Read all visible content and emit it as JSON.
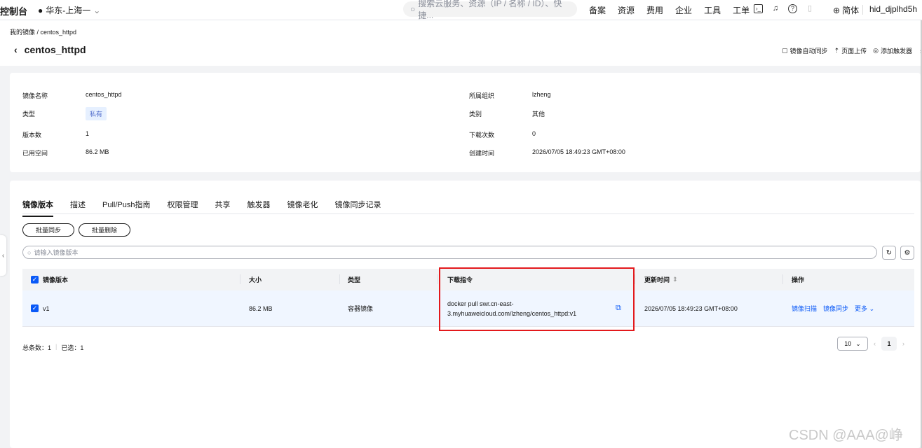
{
  "topbar": {
    "brand": "控制台",
    "region": "华东-上海一",
    "search_placeholder": "搜索云服务、资源（IP / 名称 / ID）、快捷...",
    "nav": [
      "备案",
      "资源",
      "费用",
      "企业",
      "工具",
      "工单"
    ],
    "lang": "简体",
    "user": "hid_djplhd5h"
  },
  "header": {
    "breadcrumb": "我的镜像 / centos_httpd",
    "title": "centos_httpd",
    "actions": [
      "镜像自动同步",
      "页面上传",
      "添加触发器"
    ]
  },
  "info": {
    "image_name_label": "镜像名称",
    "image_name": "centos_httpd",
    "type_label": "类型",
    "type": "私有",
    "versions_label": "版本数",
    "versions": "1",
    "used_label": "已用空间",
    "used": "86.2 MB",
    "org_label": "所属组织",
    "org": "lzheng",
    "category_label": "类别",
    "category": "其他",
    "downloads_label": "下载次数",
    "downloads": "0",
    "created_label": "创建时间",
    "created": "2026/07/05 18:49:23 GMT+08:00"
  },
  "tabs": [
    "镜像版本",
    "描述",
    "Pull/Push指南",
    "权限管理",
    "共享",
    "触发器",
    "镜像老化",
    "镜像同步记录"
  ],
  "toolbar": {
    "batch_sync": "批量同步",
    "batch_delete": "批量删除",
    "filter_placeholder": "请输入镜像版本"
  },
  "table": {
    "headers": [
      "镜像版本",
      "大小",
      "类型",
      "下载指令",
      "更新时间",
      "操作"
    ],
    "rows": [
      {
        "version": "v1",
        "size": "86.2 MB",
        "type": "容器镜像",
        "cmd1": "docker pull swr.cn-east-",
        "cmd2": "3.myhuaweicloud.com/lzheng/centos_httpd:v1",
        "updated": "2026/07/05 18:49:23 GMT+08:00",
        "op_scan": "镜像扫描",
        "op_sync": "镜像同步",
        "op_more": "更多"
      }
    ]
  },
  "footer": {
    "total": "总条数：1",
    "selected": "已选：1",
    "page_size": "10",
    "page": "1"
  },
  "watermark": "CSDN @AAA@峥"
}
